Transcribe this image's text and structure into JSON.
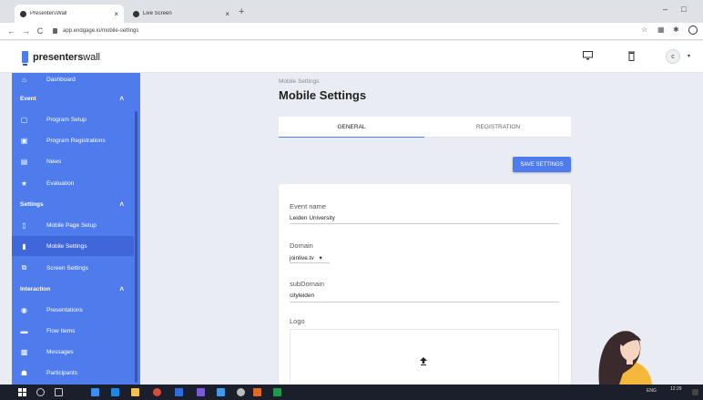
{
  "browser": {
    "tabs": [
      {
        "title": "PresentersWall",
        "close": "×"
      },
      {
        "title": "Live Screen",
        "close": "×"
      }
    ],
    "new_tab": "+",
    "url": "app.endgage.io/mobile-settings",
    "window_controls": [
      "–",
      "□"
    ],
    "nav": {
      "back": "←",
      "forward": "→",
      "reload": "C"
    }
  },
  "header": {
    "logo_bold": "presenters",
    "logo_light": "wall",
    "avatar_initial": "c",
    "caret": "▾"
  },
  "sidebar": {
    "top_item": {
      "label": "Dashboard",
      "icon": "home-icon"
    },
    "sections": [
      {
        "title": "Event",
        "chevron": "˄",
        "items": [
          {
            "label": "Program Setup",
            "icon": "calendar-icon"
          },
          {
            "label": "Program Registrations",
            "icon": "clipboard-icon"
          },
          {
            "label": "News",
            "icon": "news-icon"
          },
          {
            "label": "Evaluation",
            "icon": "star-icon"
          }
        ]
      },
      {
        "title": "Settings",
        "chevron": "˄",
        "items": [
          {
            "label": "Mobile Page Setup",
            "icon": "phone-icon"
          },
          {
            "label": "Mobile Settings",
            "icon": "phone-settings-icon",
            "active": true
          },
          {
            "label": "Screen Settings",
            "icon": "screen-icon"
          }
        ]
      },
      {
        "title": "Interaction",
        "chevron": "˄",
        "items": [
          {
            "label": "Presentations",
            "icon": "presentation-icon"
          },
          {
            "label": "Flow Items",
            "icon": "flow-icon"
          },
          {
            "label": "Messages",
            "icon": "message-icon"
          },
          {
            "label": "Participants",
            "icon": "people-icon"
          }
        ]
      }
    ]
  },
  "main": {
    "breadcrumb": "Mobile Settings",
    "title": "Mobile Settings",
    "tabs": [
      {
        "label": "GENERAL",
        "active": true
      },
      {
        "label": "REGISTRATION",
        "active": false
      }
    ],
    "save_label": "SAVE SETTINGS",
    "fields": {
      "event_name": {
        "label": "Event name",
        "value": "Leiden University"
      },
      "domain": {
        "label": "Domain",
        "value": "joinlive.tv",
        "caret": "▾"
      },
      "subdomain": {
        "label": "subDomain",
        "value": "cityleiden"
      },
      "logo": {
        "label": "Logo"
      }
    }
  },
  "taskbar": {
    "lang": "ENG",
    "time": "12:29"
  },
  "colors": {
    "accent": "#4e7ced",
    "sidebar": "#4e7ced",
    "sidebar_active": "#3f67d9",
    "background": "#e9edf3"
  }
}
